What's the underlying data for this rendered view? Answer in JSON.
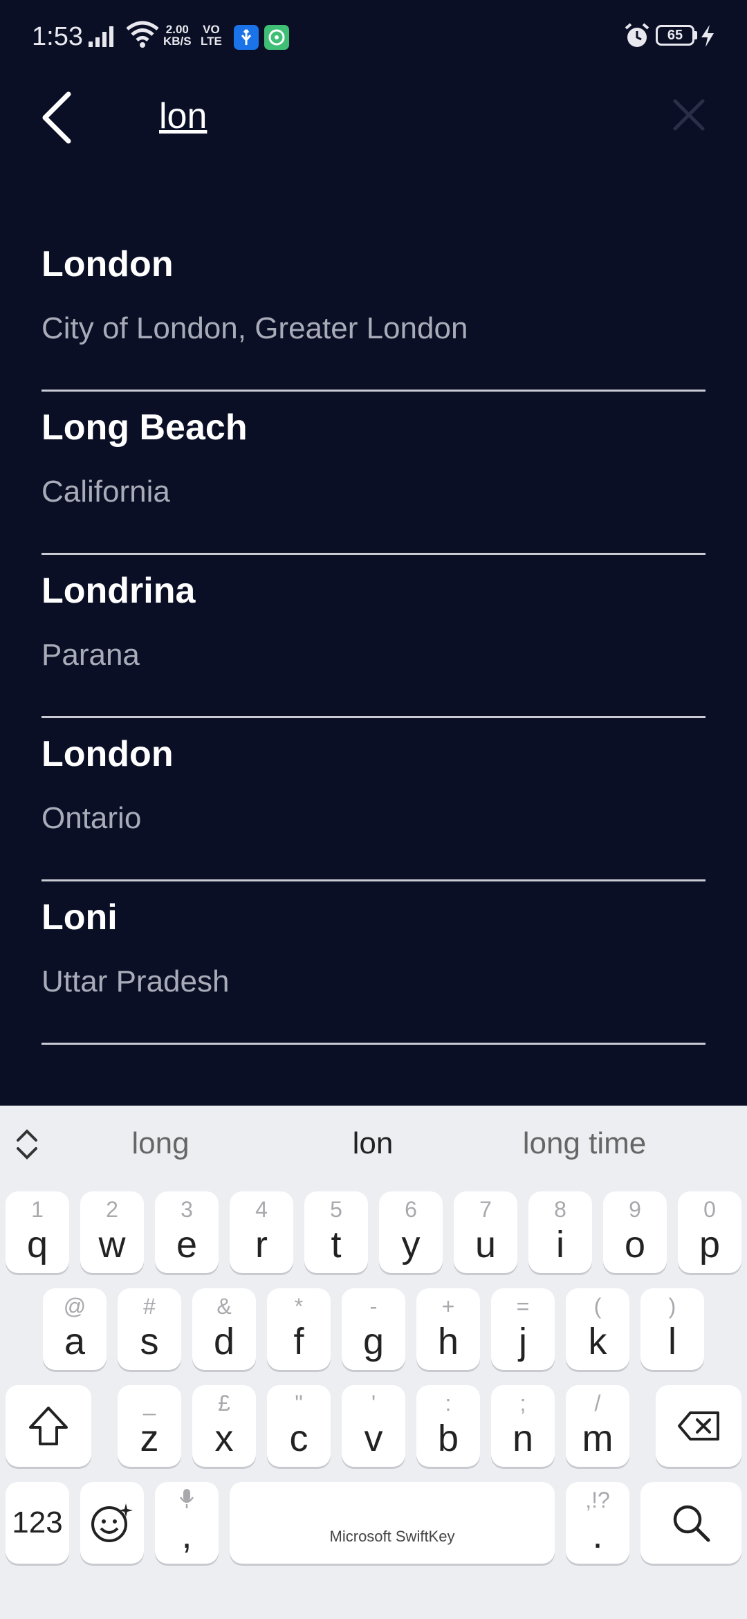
{
  "status_bar": {
    "time": "1:53",
    "net_speed_value": "2.00",
    "net_speed_unit": "KB/S",
    "volte_top": "VO",
    "volte_bottom": "LTE",
    "battery": "65"
  },
  "search": {
    "query": "lon"
  },
  "results": [
    {
      "name": "London",
      "region": "City of London, Greater London"
    },
    {
      "name": "Long Beach",
      "region": "California"
    },
    {
      "name": "Londrina",
      "region": "Parana"
    },
    {
      "name": "London",
      "region": "Ontario"
    },
    {
      "name": "Loni",
      "region": "Uttar Pradesh"
    }
  ],
  "keyboard": {
    "suggestions": [
      "long",
      "lon",
      "long time"
    ],
    "row1": [
      {
        "main": "q",
        "hint": "1"
      },
      {
        "main": "w",
        "hint": "2"
      },
      {
        "main": "e",
        "hint": "3"
      },
      {
        "main": "r",
        "hint": "4"
      },
      {
        "main": "t",
        "hint": "5"
      },
      {
        "main": "y",
        "hint": "6"
      },
      {
        "main": "u",
        "hint": "7"
      },
      {
        "main": "i",
        "hint": "8"
      },
      {
        "main": "o",
        "hint": "9"
      },
      {
        "main": "p",
        "hint": "0"
      }
    ],
    "row2": [
      {
        "main": "a",
        "hint": "@"
      },
      {
        "main": "s",
        "hint": "#"
      },
      {
        "main": "d",
        "hint": "&"
      },
      {
        "main": "f",
        "hint": "*"
      },
      {
        "main": "g",
        "hint": "-"
      },
      {
        "main": "h",
        "hint": "+"
      },
      {
        "main": "j",
        "hint": "="
      },
      {
        "main": "k",
        "hint": "("
      },
      {
        "main": "l",
        "hint": ")"
      }
    ],
    "row3": [
      {
        "main": "z",
        "hint": "_"
      },
      {
        "main": "x",
        "hint": "£"
      },
      {
        "main": "c",
        "hint": "\""
      },
      {
        "main": "v",
        "hint": "'"
      },
      {
        "main": "b",
        "hint": ":"
      },
      {
        "main": "n",
        "hint": ";"
      },
      {
        "main": "m",
        "hint": "/"
      }
    ],
    "numbers_label": "123",
    "comma_main": ",",
    "period_main": ".",
    "period_hint": ",!?",
    "space_label": "Microsoft SwiftKey",
    "icons": {
      "shift": "shift-icon",
      "backspace": "backspace-icon",
      "emoji": "emoji-icon",
      "mic": "mic-icon",
      "search": "search-icon",
      "toggle": "expand-toolbar-icon"
    }
  }
}
